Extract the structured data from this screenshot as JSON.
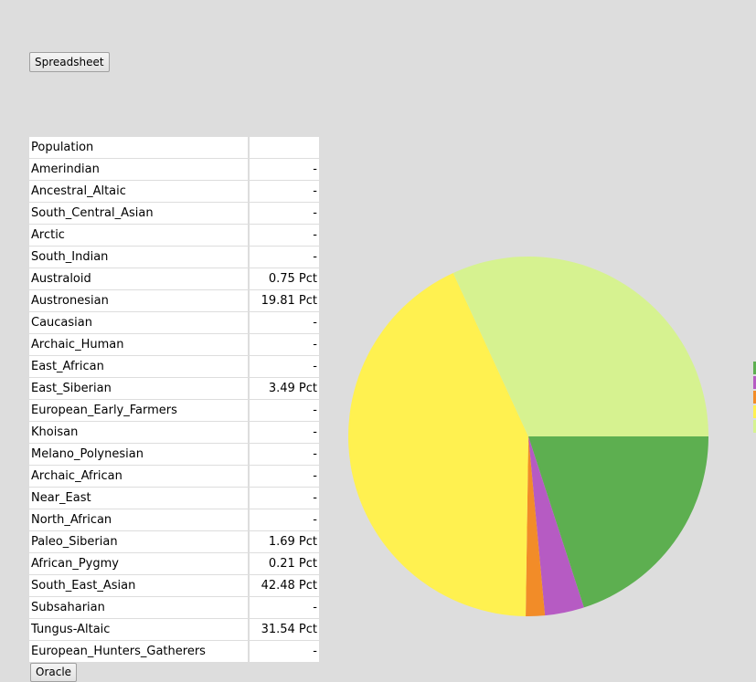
{
  "buttons": {
    "spreadsheet": "Spreadsheet",
    "oracle": "Oracle"
  },
  "table": {
    "header": "Population",
    "rows": [
      {
        "name": "Amerindian",
        "value": "-"
      },
      {
        "name": "Ancestral_Altaic",
        "value": "-"
      },
      {
        "name": "South_Central_Asian",
        "value": "-"
      },
      {
        "name": "Arctic",
        "value": "-"
      },
      {
        "name": "South_Indian",
        "value": "-"
      },
      {
        "name": "Australoid",
        "value": "0.75 Pct"
      },
      {
        "name": "Austronesian",
        "value": "19.81 Pct"
      },
      {
        "name": "Caucasian",
        "value": "-"
      },
      {
        "name": "Archaic_Human",
        "value": "-"
      },
      {
        "name": "East_African",
        "value": "-"
      },
      {
        "name": "East_Siberian",
        "value": "3.49 Pct"
      },
      {
        "name": "European_Early_Farmers",
        "value": "-"
      },
      {
        "name": "Khoisan",
        "value": "-"
      },
      {
        "name": "Melano_Polynesian",
        "value": "-"
      },
      {
        "name": "Archaic_African",
        "value": "-"
      },
      {
        "name": "Near_East",
        "value": "-"
      },
      {
        "name": "North_African",
        "value": "-"
      },
      {
        "name": "Paleo_Siberian",
        "value": "1.69 Pct"
      },
      {
        "name": "African_Pygmy",
        "value": "0.21 Pct"
      },
      {
        "name": "South_East_Asian",
        "value": "42.48 Pct"
      },
      {
        "name": "Subsaharian",
        "value": "-"
      },
      {
        "name": "Tungus-Altaic",
        "value": "31.54 Pct"
      },
      {
        "name": "European_Hunters_Gatherers",
        "value": "-"
      }
    ]
  },
  "chart_data": {
    "type": "pie",
    "slices": [
      {
        "label": "Austronesian",
        "value": 19.81,
        "color": "#5daf50"
      },
      {
        "label": "East_Siberian",
        "value": 3.49,
        "color": "#b65bc3"
      },
      {
        "label": "Paleo_Siberian",
        "value": 1.69,
        "color": "#f28c28"
      },
      {
        "label": "South_East_Asian",
        "value": 42.48,
        "color": "#fff150"
      },
      {
        "label": "Tungus-Altaic",
        "value": 31.54,
        "color": "#d6f290"
      }
    ],
    "legend_colors": [
      "#5daf50",
      "#b65bc3",
      "#f28c28",
      "#fff150",
      "#d6f290"
    ]
  }
}
